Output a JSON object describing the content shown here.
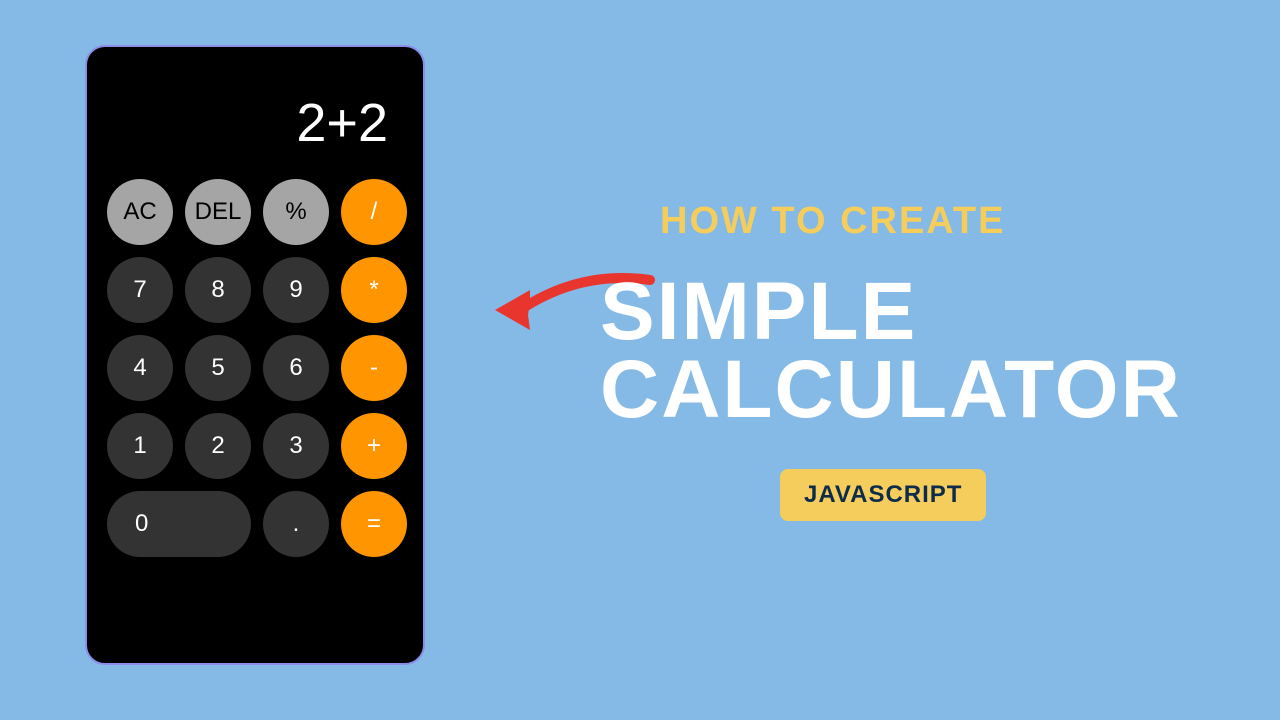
{
  "calculator": {
    "display": "2+2",
    "buttons": {
      "ac": "AC",
      "del": "DEL",
      "percent": "%",
      "divide": "/",
      "seven": "7",
      "eight": "8",
      "nine": "9",
      "multiply": "*",
      "four": "4",
      "five": "5",
      "six": "6",
      "subtract": "-",
      "one": "1",
      "two": "2",
      "three": "3",
      "add": "+",
      "zero": "0",
      "decimal": ".",
      "equals": "="
    }
  },
  "text": {
    "heading_small": "HOW TO CREATE",
    "heading_line1": "SIMPLE",
    "heading_line2": "CALCULATOR",
    "badge": "JAVASCRIPT"
  }
}
